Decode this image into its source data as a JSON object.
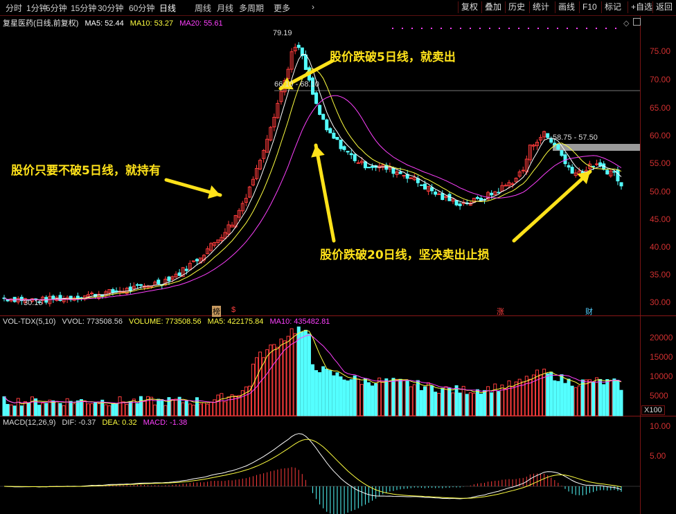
{
  "toolbar": {
    "periods": [
      "分时",
      "1分钟",
      "5分钟",
      "15分钟",
      "30分钟",
      "60分钟",
      "日线",
      "周线",
      "月线",
      "多周期",
      "更多"
    ],
    "active_period": "日线",
    "right_buttons": [
      "复权",
      "叠加",
      "历史",
      "统计",
      "画线",
      "F10",
      "标记",
      "+自选",
      "返回"
    ]
  },
  "price_panel": {
    "title": "复星医药(日线,前复权)",
    "ma5_label": "MA5: 52.44",
    "ma10_label": "MA10: 53.27",
    "ma20_label": "MA20: 55.61",
    "high_label": "79.19",
    "low_label": "30.16",
    "range_label_1": "66.10 - 68.10",
    "range_label_2": "58.75 - 57.50",
    "markers": [
      "榜",
      "$",
      "涨",
      "财"
    ],
    "y_ticks": [
      "75.00",
      "70.00",
      "65.00",
      "60.00",
      "55.00",
      "50.00",
      "45.00",
      "40.00",
      "35.00",
      "30.00"
    ]
  },
  "annotations": {
    "break_ma5": "股价跌破5日线，就卖出",
    "hold_ma5": "股价只要不破5日线，就持有",
    "break_ma20": "股价跌破20日线，坚决卖出止损"
  },
  "volume_panel": {
    "label": "VOL-TDX(5,10)",
    "vvol": "VVOL: 773508.56",
    "volume": "VOLUME: 773508.56",
    "ma5": "MA5: 422175.84",
    "ma10": "MA10: 435482.81",
    "y_ticks": [
      "20000",
      "15000",
      "10000",
      "5000"
    ],
    "unit": "X100"
  },
  "macd_panel": {
    "label": "MACD(12,26,9)",
    "dif": "DIF: -0.37",
    "dea": "DEA: 0.32",
    "macd": "MACD: -1.38",
    "y_ticks": [
      "10.00",
      "5.00"
    ]
  },
  "colors": {
    "up": "#ff3c3c",
    "down": "#54ffff",
    "ma5": "#ffffff",
    "ma10": "#ffff40",
    "ma20": "#ff40ff",
    "frame": "#8a1717",
    "annotation": "#ffe21a"
  }
}
